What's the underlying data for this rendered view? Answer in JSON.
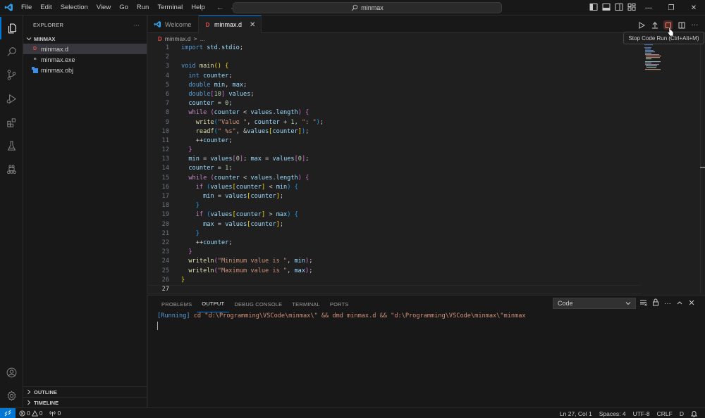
{
  "titlebar": {
    "menu": [
      "File",
      "Edit",
      "Selection",
      "View",
      "Go",
      "Run",
      "Terminal",
      "Help"
    ],
    "search_text": "minmax",
    "back_arrow": "←",
    "forward_arrow": "→",
    "minimize": "—",
    "restore": "❐",
    "close": "✕"
  },
  "activitybar": {
    "items": [
      "explorer",
      "search",
      "source-control",
      "run-and-debug",
      "extensions",
      "testing",
      "dlang-tools"
    ],
    "bottom": [
      "accounts",
      "manage"
    ]
  },
  "sidebar": {
    "title": "EXPLORER",
    "more": "···",
    "folder": "MINMAX",
    "files": [
      {
        "name": "minmax.d",
        "icon": "D",
        "selected": true
      },
      {
        "name": "minmax.exe",
        "icon": "≡",
        "selected": false
      },
      {
        "name": "minmax.obj",
        "icon": "obj",
        "selected": false
      }
    ],
    "outline": "OUTLINE",
    "timeline": "TIMELINE"
  },
  "tabs": [
    {
      "label": "Welcome",
      "active": false
    },
    {
      "label": "minmax.d",
      "active": true,
      "close": "✕"
    }
  ],
  "breadcrumb": {
    "file": "minmax.d",
    "sep": ">",
    "rest": "..."
  },
  "editor_actions": {
    "tooltip": "Stop Code Run (Ctrl+Alt+M)"
  },
  "code": {
    "current_line": 27,
    "lines": [
      "import std.stdio;",
      "",
      "void main() {",
      "  int counter;",
      "  double min, max;",
      "  double[10] values;",
      "  counter = 0;",
      "  while (counter < values.length) {",
      "    write(\"Value \", counter + 1, \": \");",
      "    readf(\" %s\", &values[counter]);",
      "    ++counter;",
      "  }",
      "  min = values[0]; max = values[0];",
      "  counter = 1;",
      "  while (counter < values.length) {",
      "    if (values[counter] < min) {",
      "      min = values[counter];",
      "    }",
      "    if (values[counter] > max) {",
      "      max = values[counter];",
      "    }",
      "    ++counter;",
      "  }",
      "  writeln(\"Minimum value is \", min);",
      "  writeln(\"Maximum value is \", max);",
      "}",
      ""
    ]
  },
  "panel": {
    "tabs": [
      {
        "label": "PROBLEMS",
        "active": false
      },
      {
        "label": "OUTPUT",
        "active": true
      },
      {
        "label": "DEBUG CONSOLE",
        "active": false
      },
      {
        "label": "TERMINAL",
        "active": false
      },
      {
        "label": "PORTS",
        "active": false
      }
    ],
    "output_channel": "Code",
    "output_running": "[Running]",
    "output_command": " cd \"d:\\Programming\\VSCode\\minmax\\\" && dmd minmax.d && \"d:\\Programming\\VSCode\\minmax\\\"minmax"
  },
  "statusbar": {
    "errors": "0",
    "warnings": "0",
    "ports": "0",
    "position": "Ln 27, Col 1",
    "spaces": "Spaces: 4",
    "encoding": "UTF-8",
    "eol": "CRLF",
    "language": "D"
  },
  "colors": {
    "accent": "#0078d4",
    "d_icon": "#e04c4c",
    "string": "#ce9178",
    "keyword": "#569cd6",
    "control": "#c586c0"
  }
}
